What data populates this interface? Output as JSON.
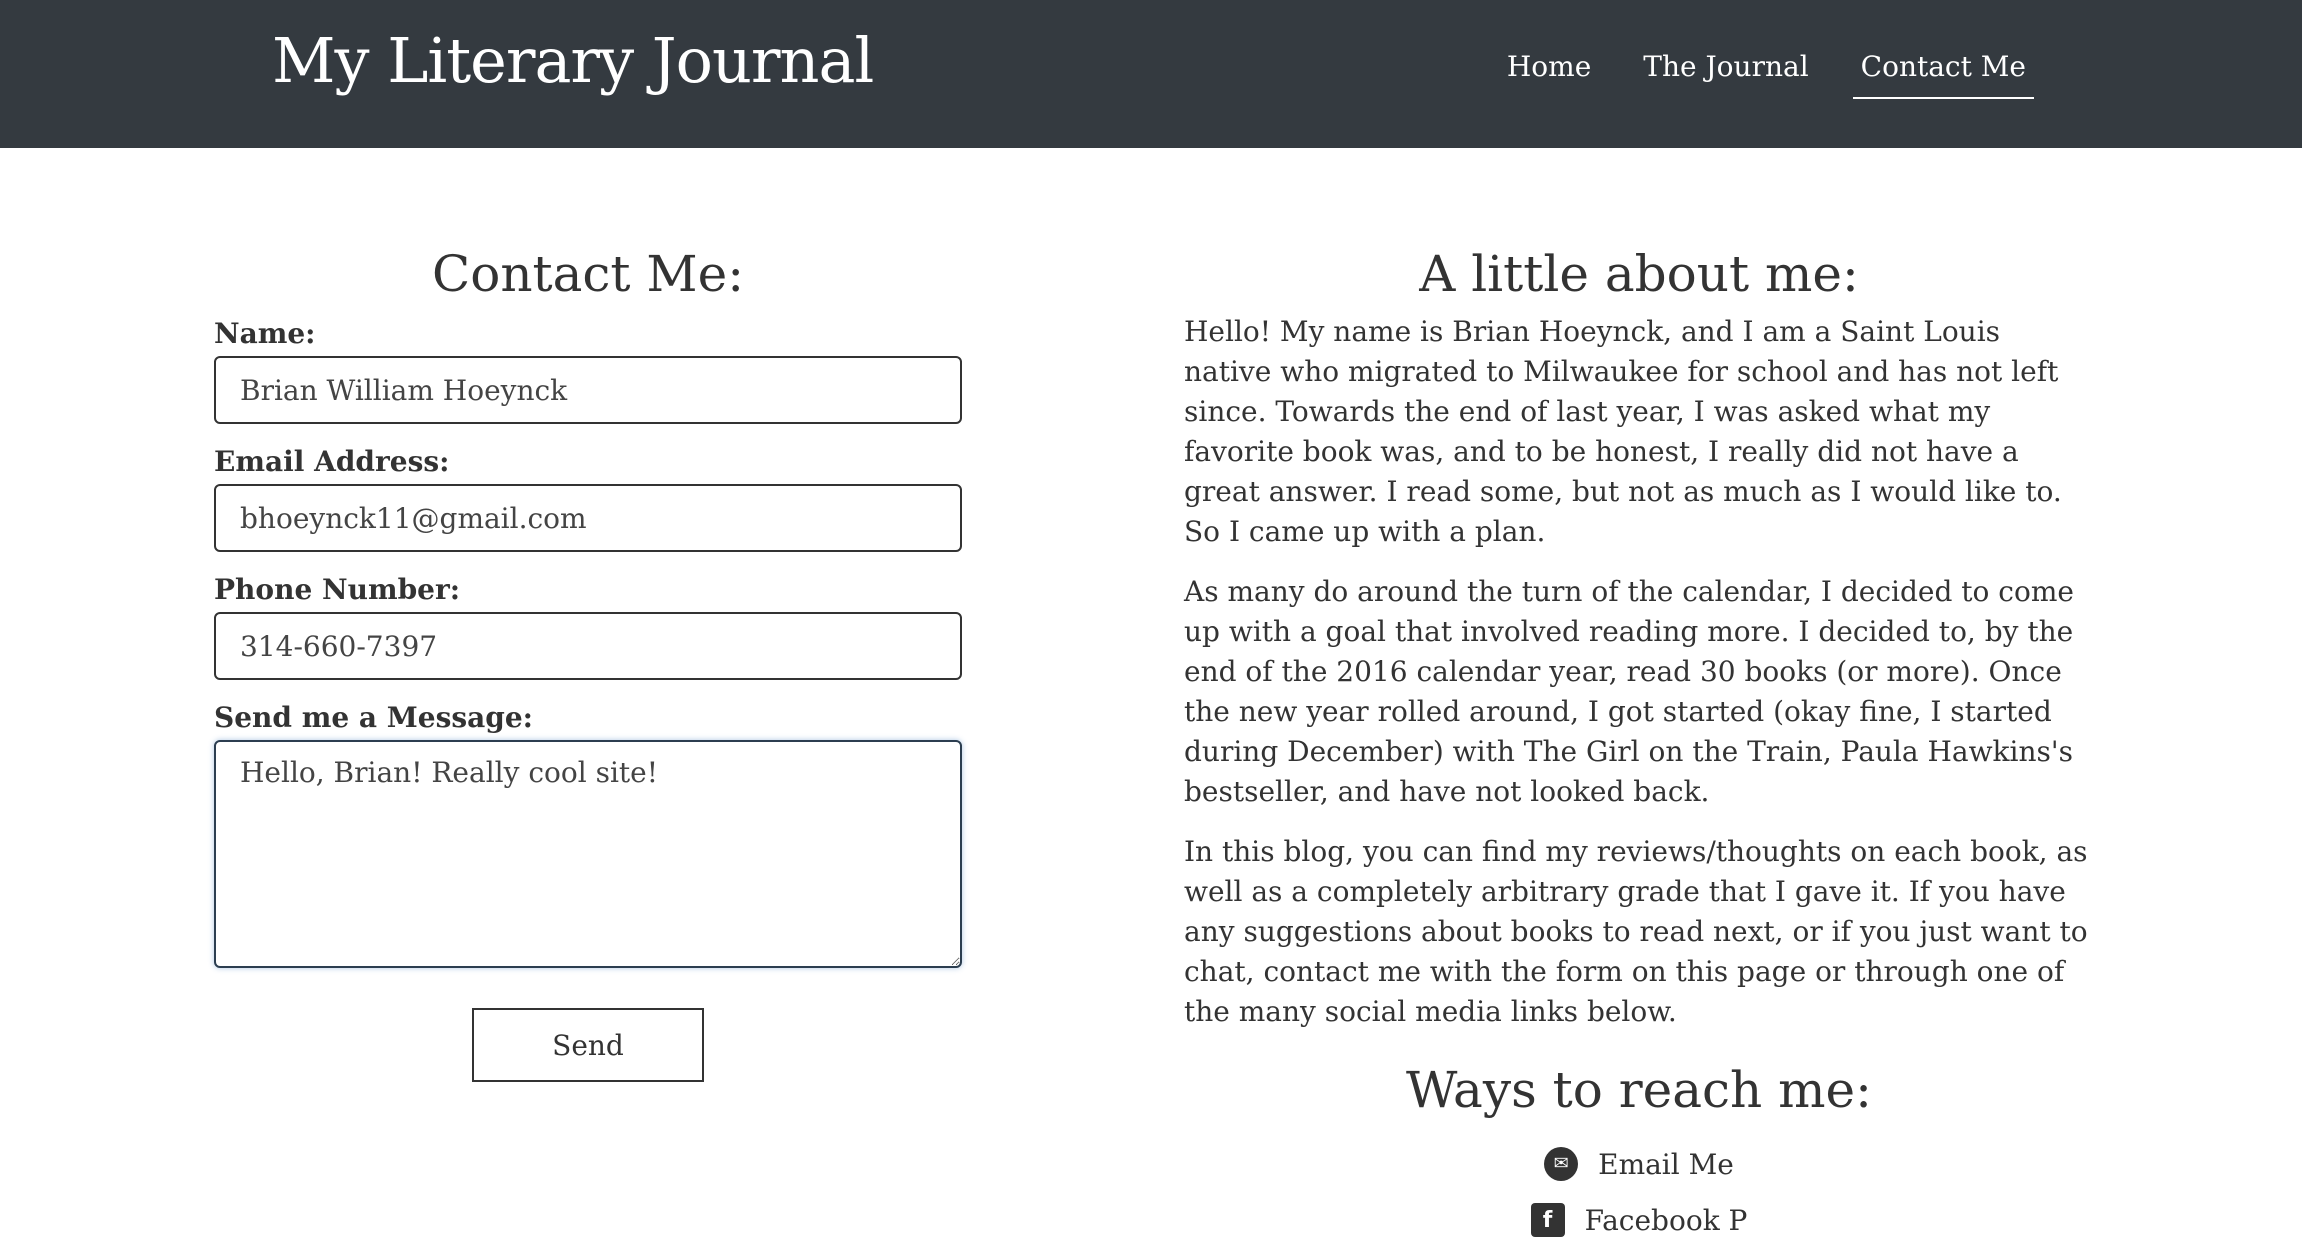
{
  "header": {
    "site_title": "My Literary Journal",
    "nav": [
      {
        "label": "Home"
      },
      {
        "label": "The Journal"
      },
      {
        "label": "Contact Me",
        "active": true
      }
    ]
  },
  "contact_form": {
    "heading": "Contact Me:",
    "name_label": "Name:",
    "name_value": "Brian William Hoeynck",
    "email_label": "Email Address:",
    "email_value": "bhoeynck11@gmail.com",
    "phone_label": "Phone Number:",
    "phone_value": "314-660-7397",
    "message_label": "Send me a Message:",
    "message_value": "Hello, Brian! Really cool site!",
    "send_label": "Send"
  },
  "about": {
    "heading": "A little about me:",
    "paragraphs": [
      "Hello! My name is Brian Hoeynck, and I am a Saint Louis native who migrated to Milwaukee for school and has not left since. Towards the end of last year, I was asked what my favorite book was, and to be honest, I really did not have a great answer. I read some, but not as much as I would like to. So I came up with a plan.",
      "As many do around the turn of the calendar, I decided to come up with a goal that involved reading more. I decided to, by the end of the 2016 calendar year, read 30 books (or more). Once the new year rolled around, I got started (okay fine, I started during December) with The Girl on the Train, Paula Hawkins's bestseller, and have not looked back.",
      "In this blog, you can find my reviews/thoughts on each book, as well as a completely arbitrary grade that I gave it. If you have any suggestions about books to read next, or if you just want to chat, contact me with the form on this page or through one of the many social media links below."
    ]
  },
  "reach": {
    "heading": "Ways to reach me:",
    "links": [
      {
        "label": "Email Me",
        "icon": "envelope-icon"
      },
      {
        "label": "Facebook P",
        "icon": "facebook-icon"
      }
    ]
  },
  "colors": {
    "header_bg": "#343a40",
    "text": "#333333",
    "background": "#ffffff"
  }
}
